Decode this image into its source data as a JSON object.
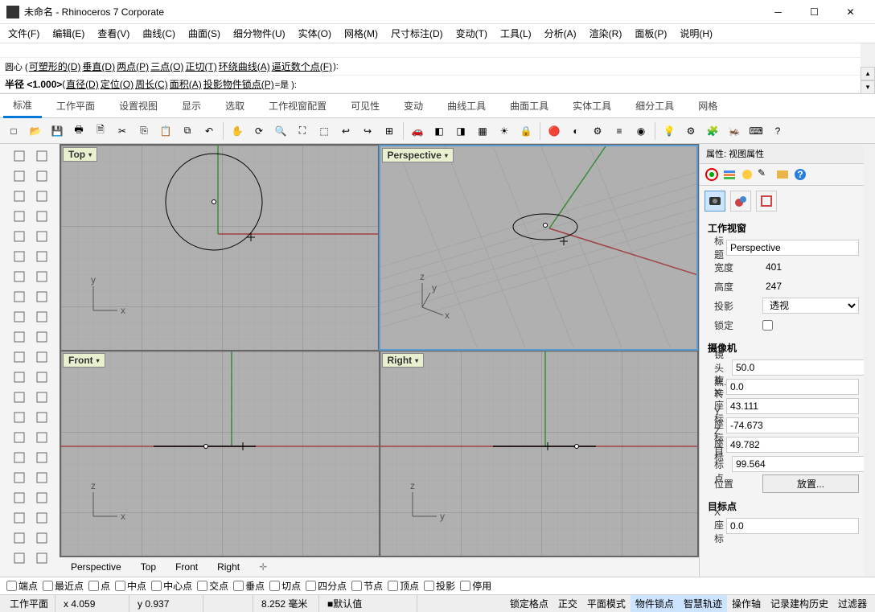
{
  "window": {
    "title": "未命名 - Rhinoceros 7 Corporate"
  },
  "menus": [
    "文件(F)",
    "编辑(E)",
    "查看(V)",
    "曲线(C)",
    "曲面(S)",
    "细分物件(U)",
    "实体(O)",
    "网格(M)",
    "尺寸标注(D)",
    "变动(T)",
    "工具(L)",
    "分析(A)",
    "渲染(R)",
    "面板(P)",
    "说明(H)"
  ],
  "cmd": {
    "line1": "",
    "line2_prefix": "圆心 ( ",
    "line2_opts": [
      "可塑形的(D)",
      "垂直(D)",
      "两点(P)",
      "三点(O)",
      "正切(T)",
      "环绕曲线(A)",
      "逼近数个点(F)"
    ],
    "line2_suffix": " ):",
    "line3_prefix": "半径 <1.000> ( ",
    "line3_opts": [
      "直径(D)",
      "定位(O)",
      "周长(C)",
      "面积(A)",
      "投影物件锁点(P)"
    ],
    "line3_eq": "=是",
    "line3_suffix": " ):"
  },
  "tabs": [
    "标准",
    "工作平面",
    "设置视图",
    "显示",
    "选取",
    "工作视窗配置",
    "可见性",
    "变动",
    "曲线工具",
    "曲面工具",
    "实体工具",
    "细分工具",
    "网格"
  ],
  "viewports": {
    "top": "Top",
    "perspective": "Perspective",
    "front": "Front",
    "right": "Right"
  },
  "panel": {
    "header": "属性: 视图属性",
    "section_viewport": "工作视窗",
    "props_viewport": {
      "title_label": "标题",
      "title": "Perspective",
      "width_label": "宽度",
      "width": "401",
      "height_label": "高度",
      "height": "247",
      "proj_label": "投影",
      "proj": "透视",
      "lock_label": "锁定"
    },
    "section_camera": "摄像机",
    "props_camera": {
      "lens_label": "镜头焦...",
      "lens": "50.0",
      "rot_label": "旋转",
      "rot": "0.0",
      "x_label": "X 座标",
      "x": "43.111",
      "y_label": "Y 座标",
      "y": "-74.673",
      "z_label": "Z 座标",
      "z": "49.782",
      "target_label": "目标点...",
      "target": "99.564",
      "pos_label": "位置",
      "pos_btn": "放置..."
    },
    "section_target": "目标点",
    "props_target": {
      "x_label": "X 座标",
      "x": "0.0"
    }
  },
  "bottom_tabs": [
    "Perspective",
    "Top",
    "Front",
    "Right"
  ],
  "osnap": [
    "端点",
    "最近点",
    "点",
    "中点",
    "中心点",
    "交点",
    "垂点",
    "切点",
    "四分点",
    "节点",
    "顶点",
    "投影",
    "停用"
  ],
  "status": {
    "cplane": "工作平面",
    "x": "x 4.059",
    "y": "y 0.937",
    "z": "",
    "units": "8.252 毫米",
    "layer": "默认值",
    "toggles": [
      "锁定格点",
      "正交",
      "平面模式",
      "物件锁点",
      "智慧轨迹",
      "操作轴",
      "记录建构历史",
      "过滤器"
    ]
  }
}
